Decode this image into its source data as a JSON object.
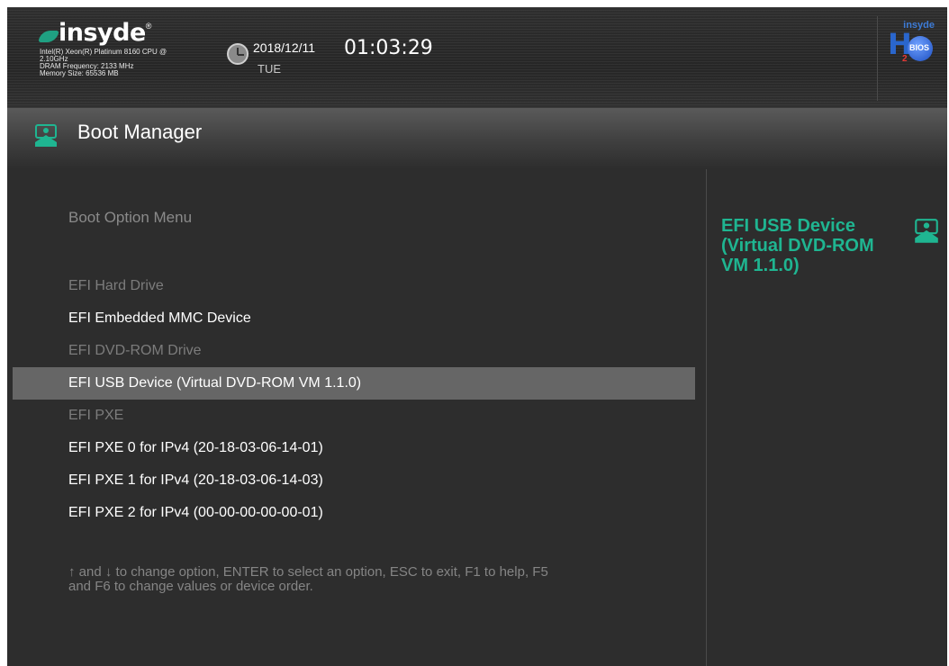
{
  "header": {
    "logo_text": "insyde",
    "logo_reg": "®",
    "cpu_line1": "Intel(R) Xeon(R) Platinum 8160 CPU @",
    "cpu_line2": "2.10GHz",
    "dram": "DRAM Frequency: 2133 MHz",
    "memory": "Memory Size: 65536 MB",
    "date": "2018/12/11",
    "time": "01:03:29",
    "day": "TUE",
    "brand_badge_top": "insyde",
    "brand_badge_h": "H",
    "brand_badge_2": "2",
    "brand_badge_bios": "BIOS"
  },
  "title_bar": {
    "title": "Boot Manager",
    "icon": "boot-manager-icon"
  },
  "main": {
    "heading": "Boot Option Menu",
    "items": [
      {
        "label": "EFI Hard Drive",
        "kind": "header"
      },
      {
        "label": "EFI Embedded MMC Device",
        "kind": "option"
      },
      {
        "label": "EFI DVD-ROM Drive",
        "kind": "header"
      },
      {
        "label": "EFI USB Device (Virtual DVD-ROM VM 1.1.0)",
        "kind": "selected"
      },
      {
        "label": "EFI PXE",
        "kind": "header"
      },
      {
        "label": "EFI PXE 0 for IPv4 (20-18-03-06-14-01)",
        "kind": "option"
      },
      {
        "label": "EFI PXE 1 for IPv4 (20-18-03-06-14-03)",
        "kind": "option"
      },
      {
        "label": "EFI PXE 2 for IPv4 (00-00-00-00-00-01)",
        "kind": "option"
      }
    ],
    "help_line1": "↑ and ↓ to change option, ENTER to select an option, ESC to exit, F1 to help, F5",
    "help_line2": "and F6 to change values or device order."
  },
  "side_panel": {
    "line1": "EFI USB Device",
    "line2": "(Virtual DVD-ROM",
    "line3": "VM 1.1.0)",
    "icon": "boot-manager-icon"
  },
  "colors": {
    "background": "#2d2d2d",
    "accent": "#1fb591",
    "selected_row": "#666666",
    "disabled_text": "#7c7c7c"
  }
}
